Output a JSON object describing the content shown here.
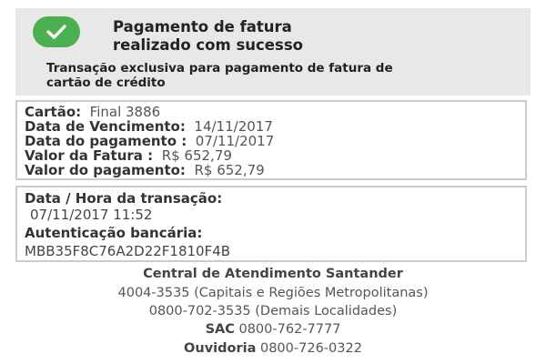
{
  "header": {
    "title_line1": "Pagamento de fatura",
    "title_line2": "realizado com sucesso",
    "notice_line1": "Transação exclusiva para pagamento de fatura de",
    "notice_line2": "cartão de crédito",
    "check_color": "#4caf50",
    "check_icon": "checkmark-icon"
  },
  "details": {
    "card_label": "Cartão:",
    "card_value": "Final 3886",
    "due_label": "Data de Vencimento:",
    "due_value": "14/11/2017",
    "paid_date_label": "Data do pagamento :",
    "paid_date_value": "07/11/2017",
    "bill_value_label": "Valor da Fatura :",
    "bill_value": "R$ 652,79",
    "paid_value_label": "Valor do pagamento:",
    "paid_value": "R$ 652,79"
  },
  "transaction": {
    "datetime_label": "Data / Hora da transação:",
    "datetime_value": "07/11/2017 11:52",
    "auth_label": "Autenticação bancária:",
    "auth_value": "MBB35F8C76A2D22F1810F4B"
  },
  "contacts": {
    "center_title": "Central de Atendimento Santander",
    "phone_capitals": "4004-3535 (Capitais e Regiões Metropolitanas)",
    "phone_other": "0800-702-3535 (Demais Localidades)",
    "sac_label": "SAC",
    "sac_phone": "0800-762-7777",
    "ombudsman_label": "Ouvidoria",
    "ombudsman_phone": "0800-726-0322"
  }
}
